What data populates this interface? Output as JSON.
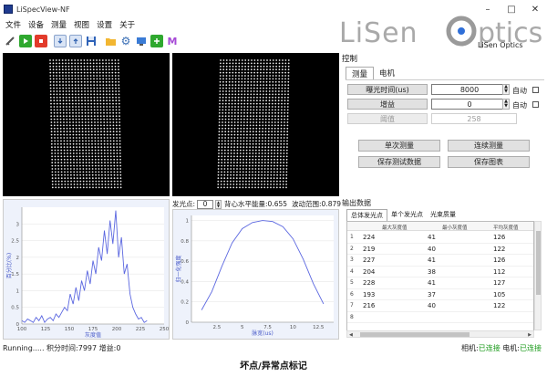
{
  "window": {
    "title": "LiSpecView-NF",
    "minimize": "–",
    "maximize": "□",
    "close": "✕"
  },
  "menu": [
    "文件",
    "设备",
    "测量",
    "视图",
    "设置",
    "关于"
  ],
  "toolbar": {
    "icons": [
      "connect-icon",
      "play-icon",
      "stop-icon",
      "download-icon",
      "upload-icon",
      "save-icon",
      "folder-icon",
      "gear-icon",
      "screen-icon",
      "add-icon",
      "mark-icon"
    ],
    "mark_label": "M"
  },
  "logo": {
    "text_big": "LiSen Optics",
    "text_small": "LiSen Optics"
  },
  "control": {
    "title": "控制",
    "tabs": [
      "测量",
      "电机"
    ],
    "exposure_label": "曝光时间(us)",
    "exposure_value": "8000",
    "gain_label": "增益",
    "gain_value": "0",
    "threshold_label": "阈值",
    "threshold_value": "258",
    "auto_label": "自动",
    "single_measure": "单次测量",
    "continuous_measure": "连续测量",
    "save_data": "保存测试数据",
    "save_chart": "保存图表"
  },
  "points_bar": {
    "label": "发光点:",
    "value": "0",
    "level": "背心水平能量:0.655",
    "range": "波动范围:0.879"
  },
  "output": {
    "title": "输出数据",
    "tabs": [
      "总体发光点",
      "单个发光点",
      "光束质量"
    ],
    "columns": [
      "最大灰度值",
      "最小灰度值",
      "平均灰度值"
    ],
    "rows": [
      [
        "1",
        "224",
        "41",
        "126"
      ],
      [
        "2",
        "219",
        "40",
        "122"
      ],
      [
        "3",
        "227",
        "41",
        "126"
      ],
      [
        "4",
        "204",
        "38",
        "112"
      ],
      [
        "5",
        "228",
        "41",
        "127"
      ],
      [
        "6",
        "193",
        "37",
        "105"
      ],
      [
        "7",
        "216",
        "40",
        "122"
      ],
      [
        "8",
        "",
        "",
        ""
      ]
    ]
  },
  "status": {
    "left": "Running..... 积分时间:7997 增益:0",
    "camera": "相机:",
    "camera_state": "已连接",
    "motor": "电机:",
    "motor_state": "已连接"
  },
  "caption": "坏点/异常点标记",
  "colors": {
    "accent": "#5b67e0",
    "ok": "#1a9a1a",
    "dot": "#e9e9e9"
  },
  "chart_data": [
    {
      "type": "line",
      "xlabel": "灰度值",
      "ylabel": "百分比(%)",
      "xlim": [
        100,
        250
      ],
      "ylim": [
        0,
        3.5
      ],
      "xticks": [
        100,
        125,
        150,
        175,
        200,
        225,
        250
      ],
      "yticks": [
        0,
        0.5,
        1,
        1.5,
        2,
        2.5,
        3
      ],
      "x": [
        100,
        103,
        106,
        109,
        112,
        115,
        118,
        121,
        124,
        127,
        130,
        133,
        136,
        139,
        142,
        145,
        148,
        151,
        154,
        157,
        160,
        163,
        166,
        169,
        172,
        175,
        178,
        181,
        184,
        187,
        190,
        193,
        196,
        199,
        202,
        205,
        208,
        211,
        214,
        217,
        220,
        223,
        226,
        229,
        232
      ],
      "y": [
        0.1,
        0.05,
        0.15,
        0.1,
        0.05,
        0.2,
        0.1,
        0.25,
        0.05,
        0.15,
        0.2,
        0.1,
        0.3,
        0.2,
        0.35,
        0.5,
        0.4,
        0.9,
        0.6,
        1.1,
        0.7,
        1.3,
        1.0,
        1.6,
        1.2,
        1.9,
        1.5,
        2.3,
        1.9,
        2.8,
        2.1,
        3.1,
        2.4,
        3.4,
        2.0,
        2.6,
        1.5,
        1.8,
        0.9,
        0.5,
        0.3,
        0.15,
        0.2,
        0.05,
        0.1
      ]
    },
    {
      "type": "line",
      "xlabel": "脉宽(us)",
      "ylabel": "归一化强度",
      "xlim": [
        0,
        14
      ],
      "ylim": [
        0,
        1.05
      ],
      "xticks": [
        2.5,
        5,
        7.5,
        10,
        12.5
      ],
      "yticks": [
        0,
        0.2,
        0.4,
        0.6,
        0.8,
        1
      ],
      "x": [
        1,
        2,
        3,
        4,
        5,
        6,
        7,
        8,
        9,
        10,
        11,
        12,
        13
      ],
      "y": [
        0.12,
        0.3,
        0.55,
        0.78,
        0.92,
        0.98,
        1.0,
        0.99,
        0.94,
        0.82,
        0.62,
        0.38,
        0.18
      ]
    }
  ]
}
